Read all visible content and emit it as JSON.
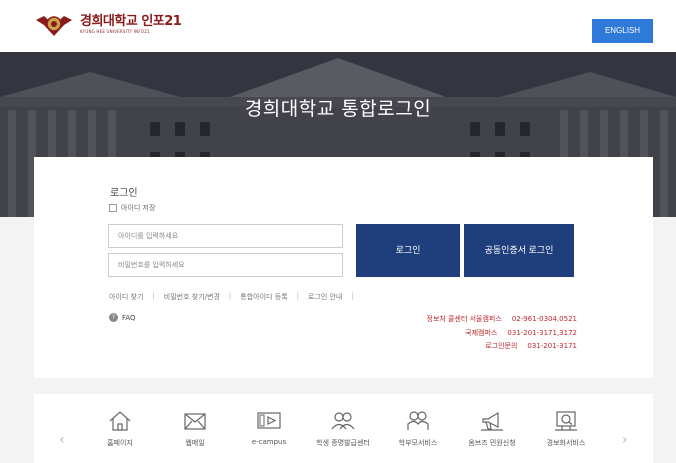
{
  "header": {
    "logo_name": "경희대학교 인포21",
    "logo_sub": "KYUNG HEE UNIVERSITY INFO21",
    "english_button": "ENGLISH"
  },
  "hero": {
    "title": "경희대학교 통합로그인"
  },
  "login": {
    "section_label": "로그인",
    "remember_label": "아이디 저장",
    "id_placeholder": "아이디를 입력하세요",
    "pw_placeholder": "비밀번호를 입력하세요",
    "login_button": "로그인",
    "cert_button": "공동인증서 로그인",
    "links": [
      "아이디 찾기",
      "비밀번호 찾기/변경",
      "통합아이디 등록",
      "로그인 안내"
    ],
    "faq": "FAQ"
  },
  "contacts": [
    {
      "label": "정보처 콜센터 서울캠퍼스",
      "number": "02-961-0304,0521"
    },
    {
      "label": "국제캠퍼스",
      "number": "031-201-3171,3172"
    },
    {
      "label": "로그인문의",
      "number": "031-201-3171"
    }
  ],
  "quick_links": [
    {
      "label": "홈페이지",
      "icon": "house-icon"
    },
    {
      "label": "웹메일",
      "icon": "mail-icon"
    },
    {
      "label": "e-campus",
      "icon": "play-screen-icon"
    },
    {
      "label": "학생 증명발급센터",
      "icon": "users-icon"
    },
    {
      "label": "학부모서비스",
      "icon": "parents-icon"
    },
    {
      "label": "옴브즈 민원신청",
      "icon": "megaphone-icon"
    },
    {
      "label": "경보화서비스",
      "icon": "search-monitor-icon"
    }
  ],
  "colors": {
    "accent_blue": "#2f7ad9",
    "button_navy": "#1f3f7c",
    "contact_red": "#c0272d",
    "brand": "#8b1a1a"
  }
}
